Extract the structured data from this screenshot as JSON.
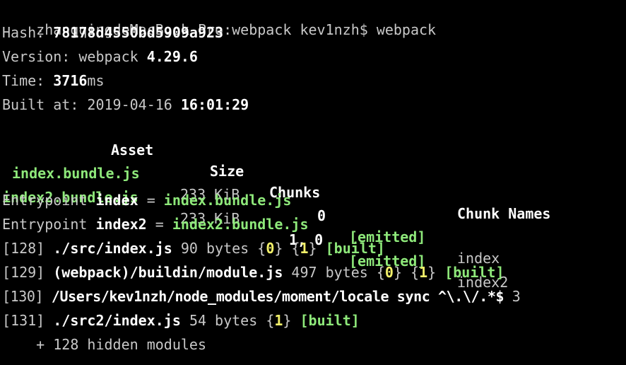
{
  "terminal": {
    "prompt": "zhangqingdeMacBook-Pro:webpack kev1nzh$ webpack",
    "hash_label": "Hash: ",
    "hash_value": "78178d4550bd5909a923",
    "version_label": "Version: webpack ",
    "version_value": "4.29.6",
    "time_label": "Time: ",
    "time_value": "3716",
    "time_unit": "ms",
    "built_label": "Built at: 2019-04-16 ",
    "built_time": "16:01:29",
    "table": {
      "headers": [
        "Asset",
        "Size",
        "Chunks",
        "Chunk Names"
      ],
      "rows": [
        {
          "asset": "index.bundle.js",
          "size": "233 KiB",
          "chunks": "0",
          "status": "[emitted]",
          "name": "index"
        },
        {
          "asset": "index2.bundle.js",
          "size": "233 KiB",
          "chunks": "1, 0",
          "status": "[emitted]",
          "name": "index2"
        }
      ]
    },
    "entrypoints": [
      {
        "label": "Entrypoint ",
        "name": "index",
        "eq": " = ",
        "file": "index.bundle.js"
      },
      {
        "label": "Entrypoint ",
        "name": "index2",
        "eq": " = ",
        "file": "index2.bundle.js"
      }
    ],
    "modules": [
      {
        "id": "[128]",
        "path": "./src/index.js",
        "size": "90 bytes",
        "chunk0": "0",
        "chunk1": "1",
        "status": "[built]"
      },
      {
        "id": "[129]",
        "path": "(webpack)/buildin/module.js",
        "size": "497 bytes",
        "chunk0": "0",
        "chunk1": "1",
        "status": "[built]"
      },
      {
        "id": "[130]",
        "path": "/Users/kev1nzh/node_modules/moment/locale sync ^\\.\\/.*$",
        "size": "3"
      },
      {
        "id": "[131]",
        "path": "./src2/index.js",
        "size": "54 bytes",
        "chunk1": "1",
        "status": "[built]"
      }
    ],
    "hidden_modules": "    + 128 hidden modules"
  }
}
